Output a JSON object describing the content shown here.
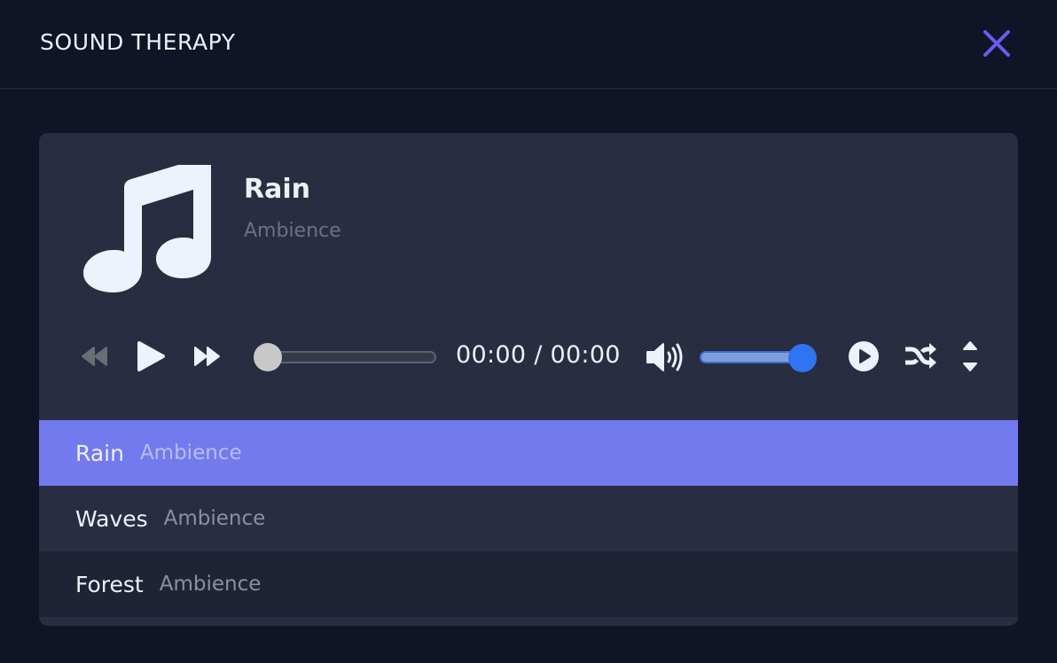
{
  "header": {
    "title": "SOUND THERAPY",
    "close_icon": "close-icon",
    "accent_color": "#6a5cf0"
  },
  "now_playing": {
    "artwork_icon": "music-note-icon",
    "title": "Rain",
    "subtitle": "Ambience"
  },
  "controls": {
    "rewind_icon": "rewind-icon",
    "play_icon": "play-icon",
    "fast_forward_icon": "fast-forward-icon",
    "progress_fraction": 0.0,
    "time_display": "00:00 / 00:00",
    "volume_icon": "volume-high-icon",
    "volume_fraction": 1.0,
    "autoplay_icon": "play-circle-icon",
    "shuffle_icon": "shuffle-icon",
    "expand_icon": "sort-up-down-icon"
  },
  "playlist": {
    "active_color": "#737aed",
    "items": [
      {
        "name": "Rain",
        "category": "Ambience",
        "active": true
      },
      {
        "name": "Waves",
        "category": "Ambience",
        "active": false
      },
      {
        "name": "Forest",
        "category": "Ambience",
        "active": false
      }
    ]
  }
}
